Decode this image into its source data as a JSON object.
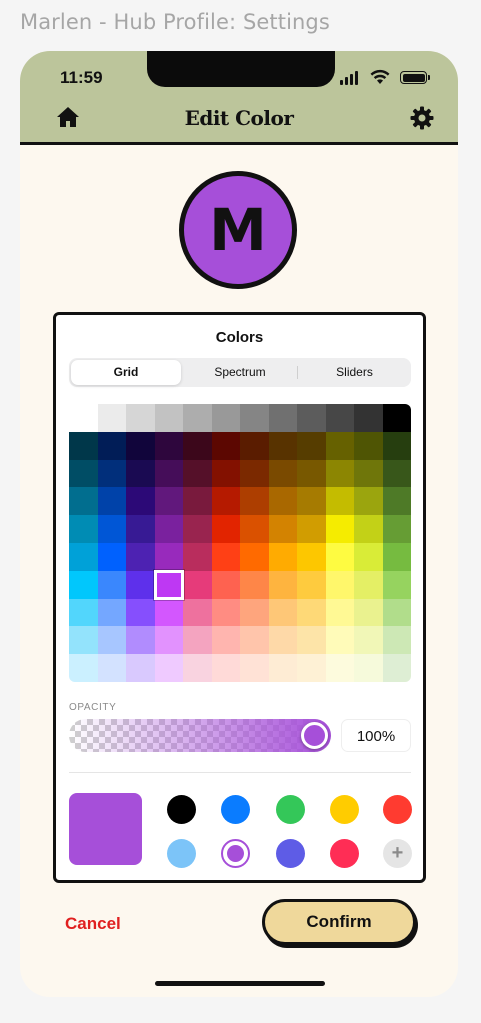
{
  "frame": {
    "title": "Marlen - Hub Profile: Settings"
  },
  "status_bar": {
    "time": "11:59",
    "signal_icon": "signal-icon",
    "wifi_icon": "wifi-icon",
    "battery_icon": "battery-icon"
  },
  "header": {
    "title": "Edit Color",
    "left_icon": "home-icon",
    "right_icon": "gear-icon",
    "background": "#bcc59b"
  },
  "avatar": {
    "initial": "M",
    "color": "#a64fd9"
  },
  "picker": {
    "title": "Colors",
    "tabs": [
      {
        "label": "Grid",
        "active": true
      },
      {
        "label": "Spectrum",
        "active": false
      },
      {
        "label": "Sliders",
        "active": false
      }
    ],
    "opacity_label": "OPACITY",
    "opacity_value": "100%",
    "opacity_fraction": 1.0,
    "current_color": "#a64fd9",
    "selected_grid_cell": {
      "row": 6,
      "col": 3
    },
    "grid_colors": [
      [
        "#ffffff",
        "#ebebeb",
        "#d6d6d6",
        "#c2c2c2",
        "#adadad",
        "#999999",
        "#858585",
        "#707070",
        "#5c5c5c",
        "#474747",
        "#333333",
        "#000000"
      ],
      [
        "#00374a",
        "#011d57",
        "#11053b",
        "#2e063d",
        "#3c071b",
        "#5c0701",
        "#5a1c00",
        "#583300",
        "#563d00",
        "#666100",
        "#4f5504",
        "#263e0f"
      ],
      [
        "#004d65",
        "#012f7b",
        "#1a0a52",
        "#450d59",
        "#551029",
        "#831100",
        "#7b2900",
        "#7a4a00",
        "#785800",
        "#8c8602",
        "#6f760a",
        "#38571a"
      ],
      [
        "#016e8f",
        "#0042a9",
        "#2c0977",
        "#61187c",
        "#791a3d",
        "#b51a00",
        "#ad3e00",
        "#a96800",
        "#a67b01",
        "#c4bc00",
        "#9ba50e",
        "#4e7a27"
      ],
      [
        "#008cb4",
        "#0056d6",
        "#371a94",
        "#7a219e",
        "#99244f",
        "#e22400",
        "#da5100",
        "#d38301",
        "#d19d01",
        "#f5ec00",
        "#c3d117",
        "#669d34"
      ],
      [
        "#00a1d8",
        "#0061fe",
        "#4d22b2",
        "#982abc",
        "#b92d5d",
        "#ff4015",
        "#ff6a00",
        "#ffab01",
        "#fdc700",
        "#fefb41",
        "#d9ec37",
        "#76bb40"
      ],
      [
        "#01c7fc",
        "#3a87fd",
        "#5e30eb",
        "#be38f3",
        "#e63b7a",
        "#fe6250",
        "#fe8648",
        "#feb43f",
        "#fecb3e",
        "#fff76b",
        "#e4ef65",
        "#96d35f"
      ],
      [
        "#52d6fc",
        "#74a7ff",
        "#864ffd",
        "#d357fe",
        "#ee719e",
        "#ff8c82",
        "#fea57d",
        "#fec777",
        "#fed977",
        "#fff994",
        "#eaf28f",
        "#b1dd8b"
      ],
      [
        "#93e3fc",
        "#a7c6ff",
        "#b18cfe",
        "#e292fe",
        "#f4a4c0",
        "#ffb5af",
        "#ffc5ab",
        "#fed9a8",
        "#fde4a8",
        "#fffbb9",
        "#f1f7b7",
        "#cde8b5"
      ],
      [
        "#cbf0ff",
        "#d3e2ff",
        "#d9c9fe",
        "#efcaff",
        "#f9d3e0",
        "#ffdad8",
        "#ffe2d6",
        "#feecd4",
        "#fef1d5",
        "#fdfbdd",
        "#f6fadb",
        "#deeed4"
      ]
    ],
    "swatches": [
      {
        "color": "#000000",
        "selected": false
      },
      {
        "color": "#0a7cff",
        "selected": false
      },
      {
        "color": "#34c759",
        "selected": false
      },
      {
        "color": "#ffcc00",
        "selected": false
      },
      {
        "color": "#ff3b30",
        "selected": false
      },
      {
        "color": "#7cc4f8",
        "selected": false
      },
      {
        "color": "#a64fd9",
        "selected": true
      },
      {
        "color": "#5e5ce6",
        "selected": false
      },
      {
        "color": "#ff2d55",
        "selected": false
      }
    ],
    "add_icon": "plus-icon"
  },
  "actions": {
    "cancel_label": "Cancel",
    "confirm_label": "Confirm"
  }
}
